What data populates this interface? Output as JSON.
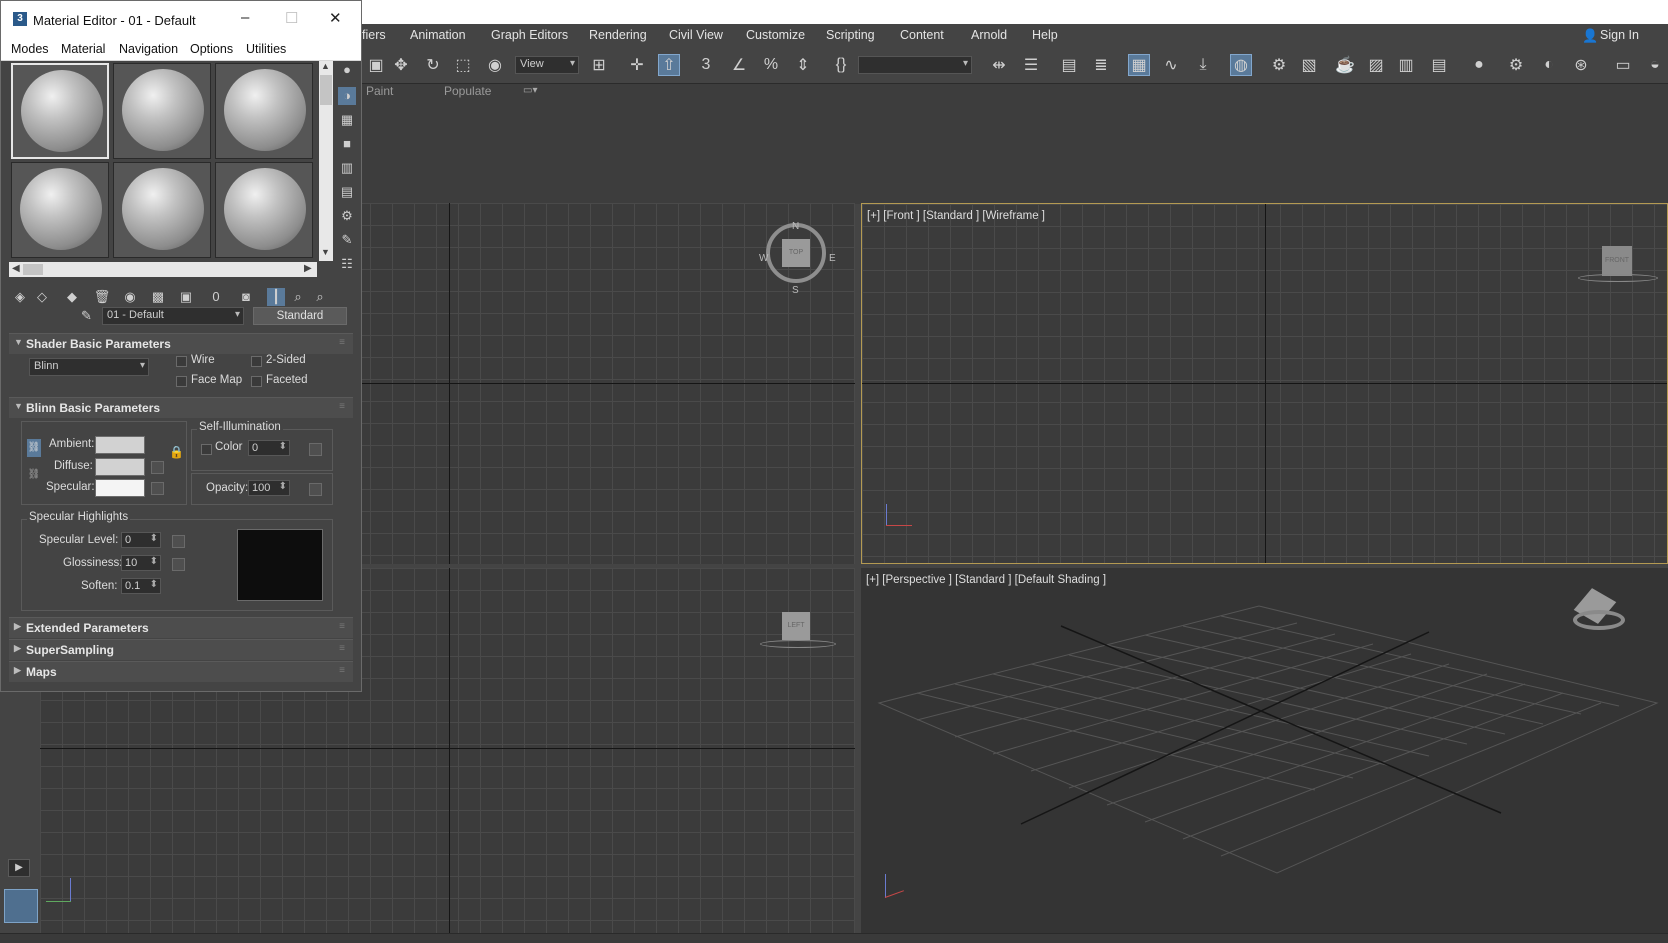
{
  "main_menu": [
    "fiers",
    "Animation",
    "Graph Editors",
    "Rendering",
    "Civil View",
    "Customize",
    "Scripting",
    "Content",
    "Arnold",
    "Help"
  ],
  "sign_in": "Sign In",
  "toolbar": {
    "view_dropdown": "View"
  },
  "ribbon": {
    "tabs": [
      "Paint",
      "Populate"
    ]
  },
  "viewports": {
    "front": "[+] [Front ] [Standard ] [Wireframe ]",
    "perspective": "[+] [Perspective ] [Standard ] [Default Shading ]",
    "top_cube": "TOP",
    "front_cube": "FRONT",
    "left_cube": "LEFT",
    "compass": {
      "n": "N",
      "s": "S",
      "e": "E",
      "w": "W"
    },
    "axis": {
      "x": "x",
      "y": "y",
      "z": "z"
    }
  },
  "material_editor": {
    "title": "Material Editor - 01 - Default",
    "app_icon": "3",
    "menus": [
      "Modes",
      "Material",
      "Navigation",
      "Options",
      "Utilities"
    ],
    "material_name": "01 - Default",
    "material_type": "Standard",
    "rollouts": {
      "shader_basic": "Shader Basic Parameters",
      "blinn_basic": "Blinn Basic Parameters",
      "extended": "Extended Parameters",
      "supersampling": "SuperSampling",
      "maps": "Maps"
    },
    "shader": {
      "type": "Blinn",
      "wire": "Wire",
      "two_sided": "2-Sided",
      "face_map": "Face Map",
      "faceted": "Faceted"
    },
    "blinn": {
      "ambient": "Ambient:",
      "diffuse": "Diffuse:",
      "specular": "Specular:",
      "self_illum": "Self-Illumination",
      "color": "Color",
      "color_value": "0",
      "opacity": "Opacity:",
      "opacity_value": "100"
    },
    "specular_highlights": {
      "title": "Specular Highlights",
      "level_label": "Specular Level:",
      "level_value": "0",
      "gloss_label": "Glossiness:",
      "gloss_value": "10",
      "soften_label": "Soften:",
      "soften_value": "0.1"
    },
    "colors": {
      "ambient": "#d2d2d2",
      "diffuse": "#d2d2d2",
      "specular": "#f4f4f4",
      "curve_bg": "#0d0d0d"
    }
  }
}
